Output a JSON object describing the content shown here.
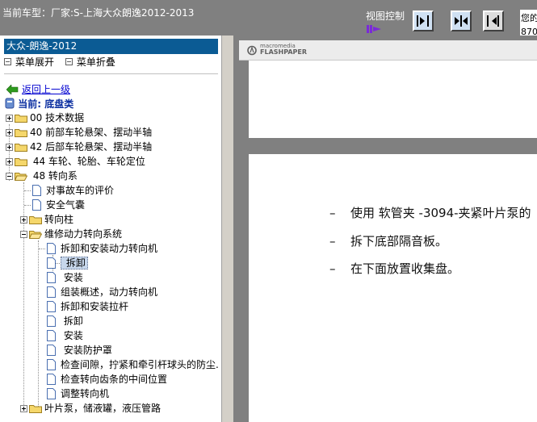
{
  "header": {
    "title": "当前车型：厂家:S-上海大众朗逸2012-2013",
    "view_control_label": "视图控制",
    "corner_text_1": "您的",
    "corner_text_2": "870"
  },
  "left_panel": {
    "car_label": "大众-朗逸-2012",
    "expand_menu": "菜单展开",
    "collapse_menu": "菜单折叠",
    "back_link": "返回上一级",
    "current_prefix": "当前:",
    "current_name": "底盘类",
    "tree": [
      {
        "label": "00 技术数据"
      },
      {
        "label": "40 前部车轮悬架、摆动半轴"
      },
      {
        "label": "42 后部车轮悬架、摆动半轴"
      },
      {
        "label": " 44 车轮、轮胎、车轮定位"
      },
      {
        "label": " 48 转向系"
      },
      {
        "label": "对事故车的评价"
      },
      {
        "label": "安全气囊"
      },
      {
        "label": "转向柱"
      },
      {
        "label": "维修动力转向系统"
      },
      {
        "label": "拆卸和安装动力转向机"
      },
      {
        "label": " 拆卸"
      },
      {
        "label": " 安装"
      },
      {
        "label": "组装概述，动力转向机"
      },
      {
        "label": "拆卸和安装拉杆"
      },
      {
        "label": " 拆卸"
      },
      {
        "label": " 安装"
      },
      {
        "label": " 安装防护罩"
      },
      {
        "label": "检查间隙，拧紧和牵引杆球头的防尘..."
      },
      {
        "label": "检查转向齿条的中间位置"
      },
      {
        "label": "调整转向机"
      },
      {
        "label": "叶片泵，储液罐，液压管路"
      }
    ]
  },
  "viewer": {
    "logo_top": "macromedia",
    "logo_bottom": "FLASHPAPER",
    "dash": "–",
    "bullets": [
      "使用 软管夹 -3094-夹紧叶片泵的",
      "拆下底部隔音板。",
      "在下面放置收集盘。"
    ]
  },
  "colors": {
    "toolbar": "#808080",
    "car_bar": "#0b5b94",
    "link": "#0000d0",
    "current": "#0a2ea0",
    "selection": "#c7d7ec"
  },
  "icons": [
    "back-arrow-icon",
    "chassis-icon",
    "folder-icon",
    "document-icon",
    "fit-width-icon",
    "two-page-icon",
    "fit-page-icon",
    "purple-control-icon"
  ]
}
